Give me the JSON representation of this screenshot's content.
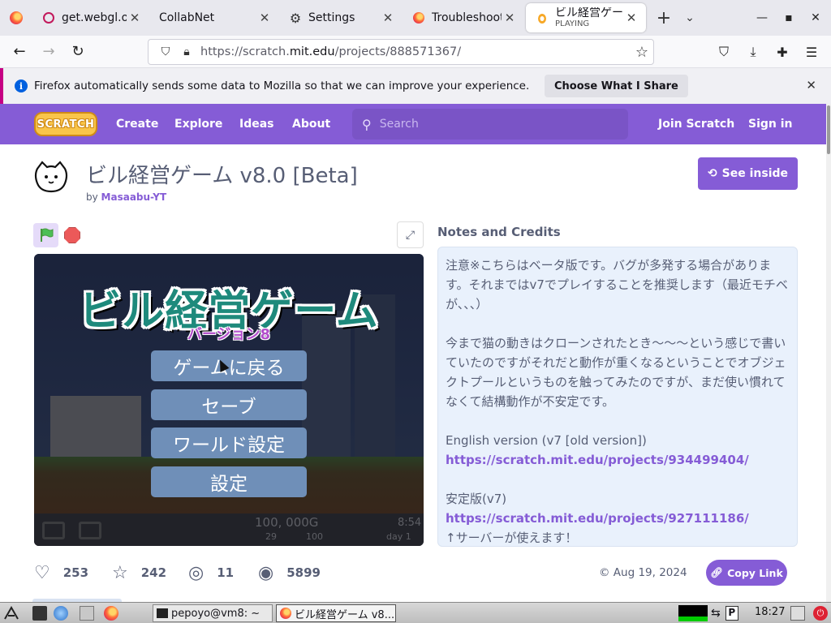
{
  "browser": {
    "tabs": [
      {
        "title": "get.webgl.org/",
        "icon": "red-ring-icon"
      },
      {
        "title": "CollabNet",
        "icon": "none"
      },
      {
        "title": "Settings",
        "icon": "gear-icon"
      },
      {
        "title": "Troubleshootin",
        "icon": "firefox-icon"
      },
      {
        "title": "ビル経営ゲーム",
        "subtitle": "PLAYING",
        "icon": "scratch-cat-icon",
        "active": true
      }
    ],
    "url_prefix": "https://scratch.",
    "url_domain": "mit.edu",
    "url_suffix": "/projects/888571367/"
  },
  "notification": {
    "message": "Firefox automatically sends some data to Mozilla so that we can improve your experience.",
    "button": "Choose What I Share"
  },
  "scratch_nav": {
    "logo": "SCRATCH",
    "create": "Create",
    "explore": "Explore",
    "ideas": "Ideas",
    "about": "About",
    "search_placeholder": "Search",
    "join": "Join Scratch",
    "signin": "Sign in"
  },
  "project": {
    "title": "ビル経営ゲーム v8.0 [Beta]",
    "by_label": "by",
    "author": "Masaabu-YT",
    "see_inside": "See inside"
  },
  "stage": {
    "game_title": "ビル経営ゲーム",
    "game_subtitle": "バージョン8",
    "buttons": [
      "ゲームに戻る",
      "セーブ",
      "ワールド設定",
      "設定"
    ],
    "hud_money": "100, 000G",
    "hud_time": "8:54",
    "hud_stat1": "29",
    "hud_stat2": "100",
    "hud_day": "day 1"
  },
  "notes": {
    "heading": "Notes and Credits",
    "para1": "注意※こちらはベータ版です。バグが多発する場合があります。それまではv7でプレイすることを推奨します（最近モチベが、、、）",
    "para2": "今まで猫の動きはクローンされたとき～～～という感じで書いていたのですがそれだと動作が重くなるということでオブジェクトプールというものを触ってみたのですが、まだ使い慣れてなくて結構動作が不安定です。",
    "english_label": "English version (v7 [old version])",
    "english_link": "https://scratch.mit.edu/projects/934499404/",
    "stable_label": "安定版(v7)",
    "stable_link": "https://scratch.mit.edu/projects/927111186/",
    "server_note": "↑サーバーが使えます！"
  },
  "stats": {
    "loves": "253",
    "favorites": "242",
    "remixes": "11",
    "views": "5899",
    "date": "© Aug 19, 2024",
    "copy_link": "Copy Link"
  },
  "taskbar": {
    "terminal": "pepoyo@vm8: ~",
    "browser": "ビル経営ゲーム v8...",
    "clock": "18:27"
  },
  "colors": {
    "scratch_purple": "#855cd6",
    "notes_bg": "#e9f1fc",
    "notification_accent": "#c60084"
  }
}
